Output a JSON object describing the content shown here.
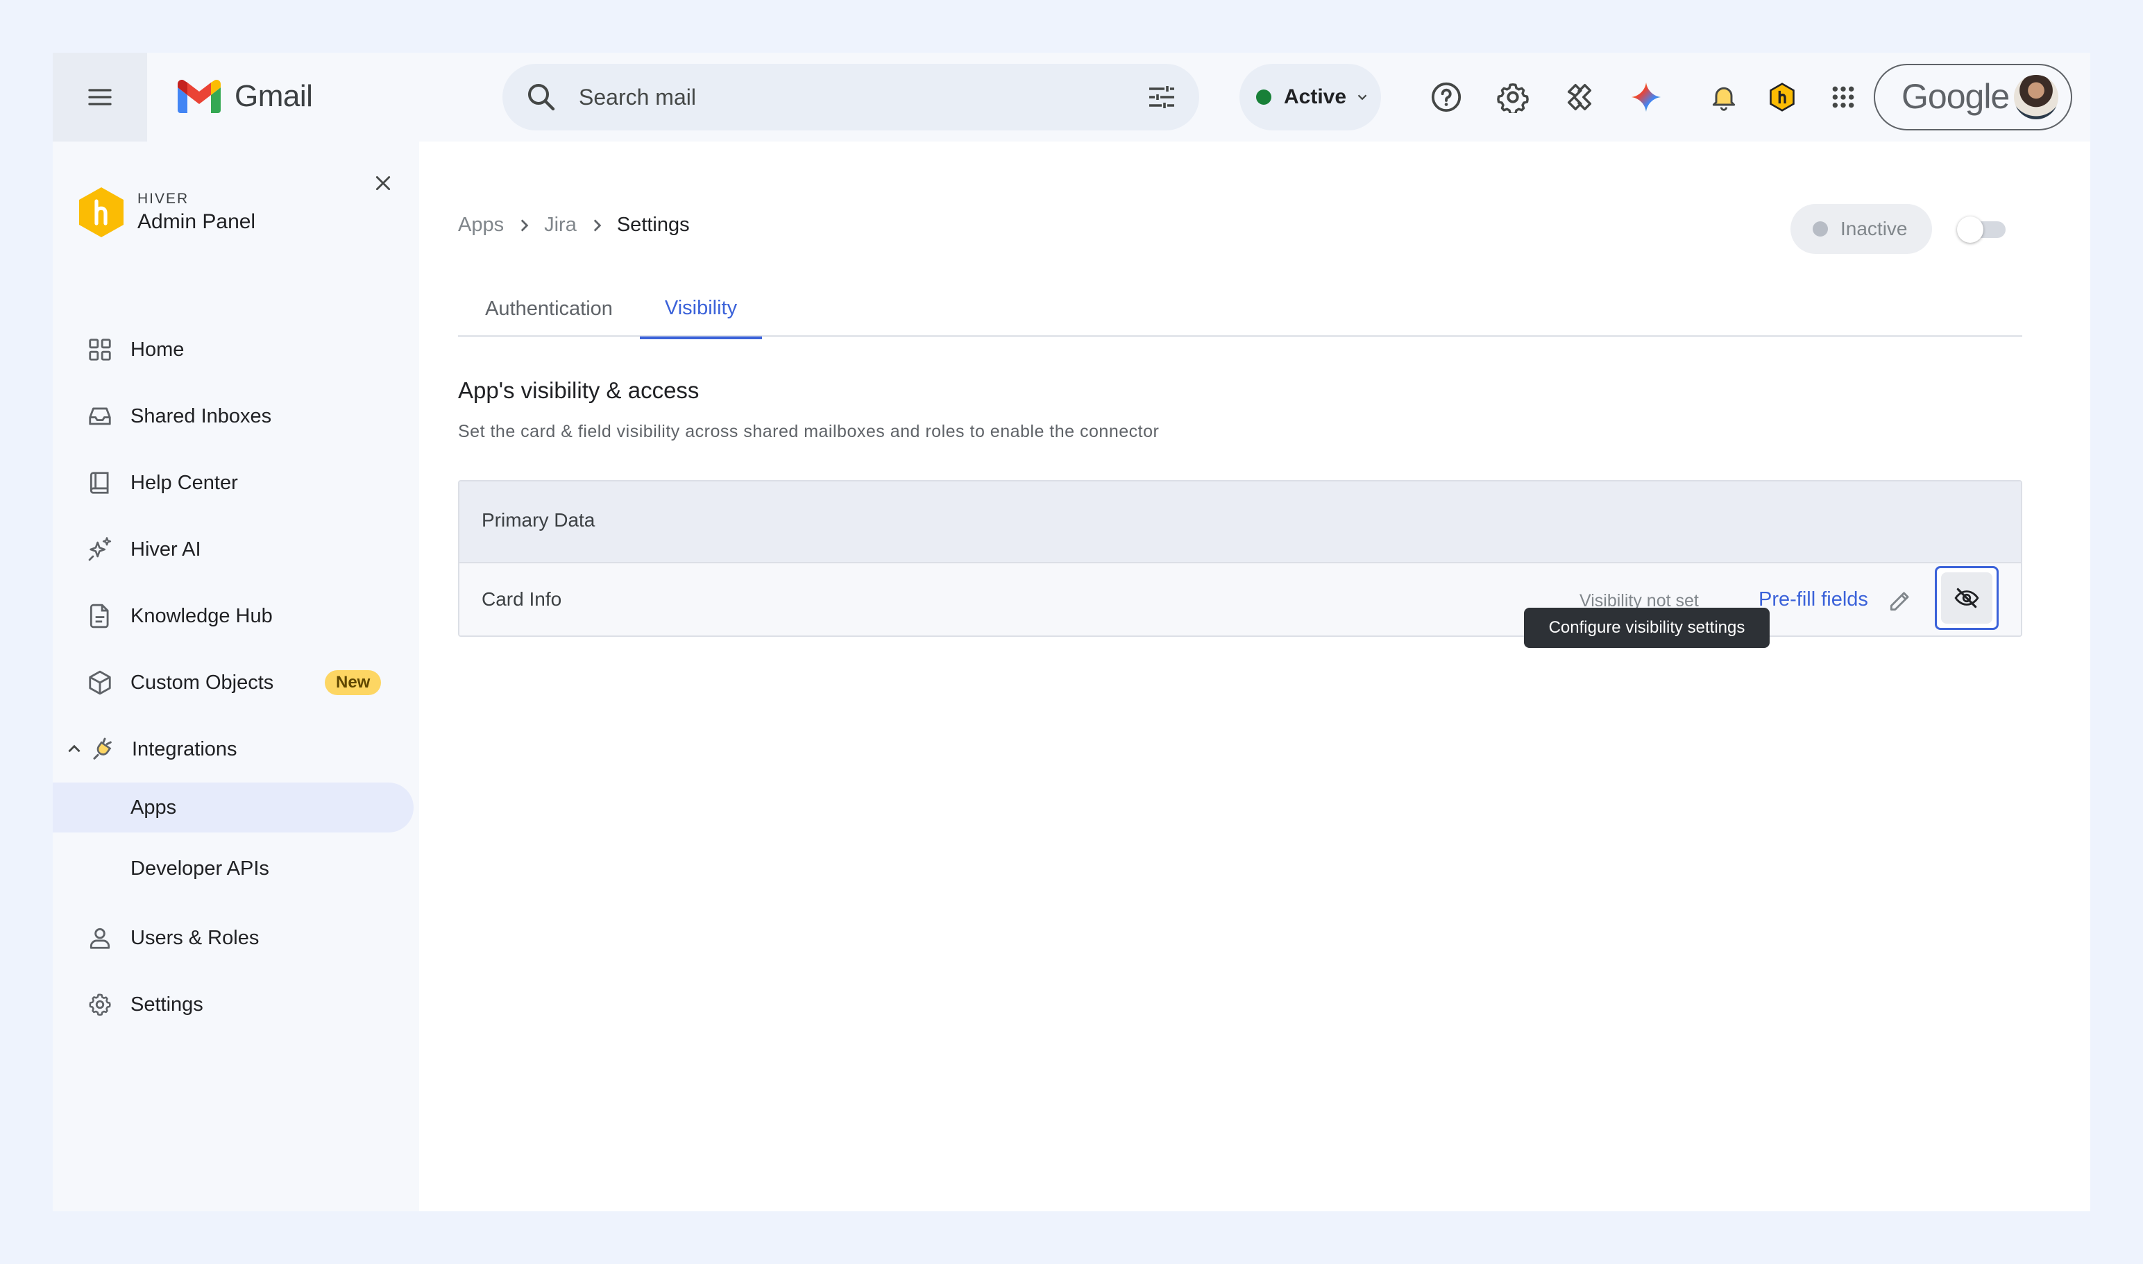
{
  "gmail": {
    "app_name": "Gmail",
    "search_placeholder": "Search mail",
    "status": "Active",
    "status_color": "#188038",
    "account_label": "Google",
    "icons": [
      "menu-icon",
      "search-icon",
      "tune-icon",
      "help-icon",
      "settings-icon",
      "support-agent-icon",
      "gemini-icon",
      "bell-icon",
      "hiver-extension-icon",
      "apps-grid-icon"
    ]
  },
  "sidebar": {
    "brand_small": "HIVER",
    "brand_title": "Admin Panel",
    "items": [
      {
        "label": "Home",
        "icon": "home-grid-icon"
      },
      {
        "label": "Shared Inboxes",
        "icon": "inbox-icon"
      },
      {
        "label": "Help Center",
        "icon": "book-icon"
      },
      {
        "label": "Hiver AI",
        "icon": "sparkle-icon"
      },
      {
        "label": "Knowledge Hub",
        "icon": "document-icon"
      },
      {
        "label": "Custom Objects",
        "icon": "cube-icon",
        "badge": "New"
      },
      {
        "label": "Integrations",
        "icon": "plug-icon",
        "expanded": true
      },
      {
        "label": "Apps",
        "active": true
      },
      {
        "label": "Developer APIs"
      },
      {
        "label": "Users & Roles",
        "icon": "user-icon"
      },
      {
        "label": "Settings",
        "icon": "gear-icon"
      }
    ]
  },
  "main": {
    "breadcrumb": [
      "Apps",
      "Jira",
      "Settings"
    ],
    "app_status": "Inactive",
    "toggle_on": false,
    "tabs": [
      {
        "label": "Authentication",
        "active": false
      },
      {
        "label": "Visibility",
        "active": true
      }
    ],
    "section_title": "App's visibility & access",
    "section_desc": "Set the card & field visibility across shared mailboxes and roles to enable the connector",
    "table": {
      "header": "Primary Data",
      "rows": [
        {
          "label": "Card Info",
          "status": "Visibility not set",
          "link": "Pre-fill fields"
        }
      ]
    },
    "tooltip": "Configure visibility settings",
    "accent_color": "#3b62d9"
  }
}
